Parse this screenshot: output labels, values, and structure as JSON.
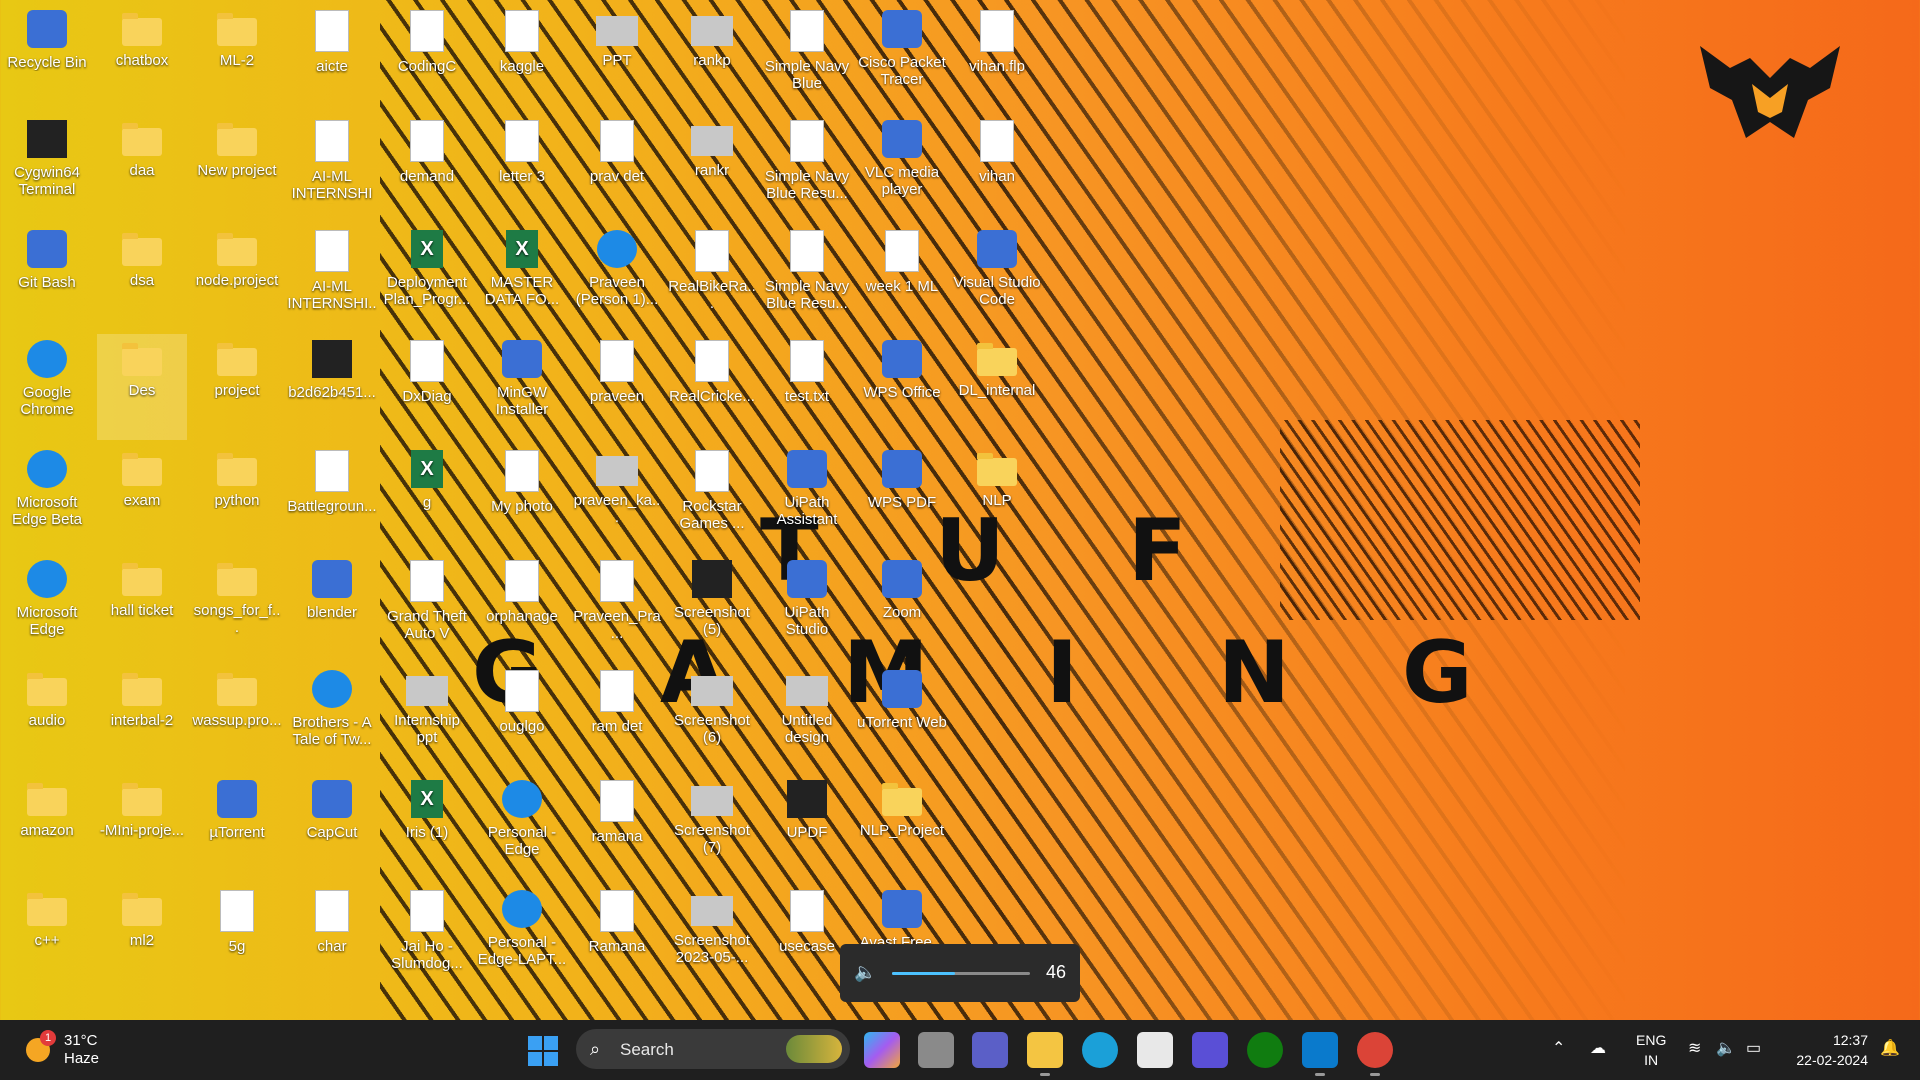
{
  "wallpaper": {
    "tuf_letters": [
      "T",
      "U",
      "F"
    ],
    "gaming_letters": [
      "G",
      "A",
      "M",
      "I",
      "N",
      "G"
    ]
  },
  "desktop_icons": [
    {
      "label": "Recycle Bin",
      "type": "app",
      "icon": "recycle-bin-icon"
    },
    {
      "label": "chatbox",
      "type": "folder",
      "icon": "folder-icon"
    },
    {
      "label": "ML-2",
      "type": "folder",
      "icon": "folder-icon"
    },
    {
      "label": "aicte",
      "type": "file",
      "icon": "document-icon"
    },
    {
      "label": "CodingC",
      "type": "file",
      "icon": "shortcut-icon"
    },
    {
      "label": "kaggle",
      "type": "file",
      "icon": "document-icon"
    },
    {
      "label": "PPT",
      "type": "img",
      "icon": "image-icon"
    },
    {
      "label": "rankp",
      "type": "img",
      "icon": "image-icon"
    },
    {
      "label": "Simple Navy Blue Resume",
      "type": "file",
      "icon": "document-icon"
    },
    {
      "label": "Cisco Packet Tracer",
      "type": "app",
      "icon": "cisco-icon"
    },
    {
      "label": "vihan.flp",
      "type": "file",
      "icon": "file-icon"
    },
    {
      "label": "Cygwin64 Terminal",
      "type": "dark",
      "icon": "terminal-icon"
    },
    {
      "label": "daa",
      "type": "folder",
      "icon": "folder-icon"
    },
    {
      "label": "New project",
      "type": "folder",
      "icon": "folder-icon"
    },
    {
      "label": "AI-ML INTERNSHIP",
      "type": "file",
      "icon": "document-icon"
    },
    {
      "label": "demand",
      "type": "file",
      "icon": "document-icon"
    },
    {
      "label": "letter 3",
      "type": "file",
      "icon": "document-icon"
    },
    {
      "label": "prav det",
      "type": "file",
      "icon": "document-icon"
    },
    {
      "label": "rankr",
      "type": "img",
      "icon": "image-icon"
    },
    {
      "label": "Simple Navy Blue Resu...",
      "type": "file",
      "icon": "document-icon"
    },
    {
      "label": "VLC media player",
      "type": "app",
      "icon": "vlc-icon"
    },
    {
      "label": "vihan",
      "type": "file",
      "icon": "media-icon"
    },
    {
      "label": "Git Bash",
      "type": "app",
      "icon": "git-icon"
    },
    {
      "label": "dsa",
      "type": "folder",
      "icon": "folder-icon"
    },
    {
      "label": "node.project",
      "type": "folder",
      "icon": "folder-icon"
    },
    {
      "label": "AI-ML INTERNSHI...",
      "type": "file",
      "icon": "document-icon"
    },
    {
      "label": "Deployment Plan_Progr...",
      "type": "excel",
      "icon": "excel-icon"
    },
    {
      "label": "MASTER DATA FO...",
      "type": "excel",
      "icon": "excel-icon"
    },
    {
      "label": "Praveen (Person 1)...",
      "type": "round",
      "icon": "chrome-icon"
    },
    {
      "label": "RealBikeRa...",
      "type": "file",
      "icon": "shortcut-icon"
    },
    {
      "label": "Simple Navy Blue Resu...",
      "type": "file",
      "icon": "document-icon"
    },
    {
      "label": "week 1 ML",
      "type": "file",
      "icon": "document-icon"
    },
    {
      "label": "Visual Studio Code",
      "type": "app",
      "icon": "vscode-icon"
    },
    {
      "label": "Google Chrome",
      "type": "round",
      "icon": "chrome-icon"
    },
    {
      "label": "Des",
      "type": "folder",
      "icon": "folder-icon",
      "selected": true
    },
    {
      "label": "project",
      "type": "folder",
      "icon": "folder-icon"
    },
    {
      "label": "b2d62b451...",
      "type": "dark",
      "icon": "image-icon"
    },
    {
      "label": "DxDiag",
      "type": "file",
      "icon": "document-icon"
    },
    {
      "label": "MinGW Installer",
      "type": "app",
      "icon": "mingw-icon"
    },
    {
      "label": "praveen",
      "type": "file",
      "icon": "document-icon"
    },
    {
      "label": "RealCricke...",
      "type": "file",
      "icon": "shortcut-icon"
    },
    {
      "label": "test.txt",
      "type": "file",
      "icon": "text-file-icon"
    },
    {
      "label": "WPS Office",
      "type": "app",
      "icon": "wps-icon"
    },
    {
      "label": "DL_internal",
      "type": "folder",
      "icon": "folder-icon"
    },
    {
      "label": "Microsoft Edge Beta",
      "type": "round",
      "icon": "edge-beta-icon"
    },
    {
      "label": "exam",
      "type": "folder",
      "icon": "folder-icon"
    },
    {
      "label": "python",
      "type": "folder",
      "icon": "folder-icon"
    },
    {
      "label": "Battlegroun...",
      "type": "file",
      "icon": "shortcut-icon"
    },
    {
      "label": "g",
      "type": "excel",
      "icon": "excel-icon"
    },
    {
      "label": "My photo",
      "type": "file",
      "icon": "photo-icon"
    },
    {
      "label": "praveen_ka...",
      "type": "img",
      "icon": "image-icon"
    },
    {
      "label": "Rockstar Games ...",
      "type": "file",
      "icon": "shortcut-icon"
    },
    {
      "label": "UiPath Assistant",
      "type": "app",
      "icon": "uipath-icon"
    },
    {
      "label": "WPS PDF",
      "type": "app",
      "icon": "wps-pdf-icon"
    },
    {
      "label": "NLP",
      "type": "folder",
      "icon": "folder-icon"
    },
    {
      "label": "Microsoft Edge",
      "type": "round",
      "icon": "edge-icon"
    },
    {
      "label": "hall ticket",
      "type": "folder",
      "icon": "folder-icon"
    },
    {
      "label": "songs_for_f...",
      "type": "folder",
      "icon": "folder-icon"
    },
    {
      "label": "blender",
      "type": "app",
      "icon": "blender-icon"
    },
    {
      "label": "Grand Theft Auto V",
      "type": "file",
      "icon": "shortcut-icon"
    },
    {
      "label": "orphanage",
      "type": "file",
      "icon": "document-icon"
    },
    {
      "label": "Praveen_Pra...",
      "type": "file",
      "icon": "document-icon"
    },
    {
      "label": "Screenshot (5)",
      "type": "dark",
      "icon": "image-icon"
    },
    {
      "label": "UiPath Studio",
      "type": "app",
      "icon": "uipath-studio-icon"
    },
    {
      "label": "Zoom",
      "type": "app",
      "icon": "zoom-icon"
    },
    {
      "label": "audio",
      "type": "folder",
      "icon": "folder-icon"
    },
    {
      "label": "interbal-2",
      "type": "folder",
      "icon": "folder-icon"
    },
    {
      "label": "wassup.pro...",
      "type": "folder",
      "icon": "folder-icon"
    },
    {
      "label": "Brothers - A Tale of Tw...",
      "type": "round",
      "icon": "globe-icon"
    },
    {
      "label": "Internship ppt",
      "type": "img",
      "icon": "image-icon"
    },
    {
      "label": "ouglgo",
      "type": "file",
      "icon": "document-icon"
    },
    {
      "label": "ram det",
      "type": "file",
      "icon": "document-icon"
    },
    {
      "label": "Screenshot (6)",
      "type": "img",
      "icon": "image-icon"
    },
    {
      "label": "Untitled design",
      "type": "img",
      "icon": "image-icon"
    },
    {
      "label": "uTorrent Web",
      "type": "app",
      "icon": "utorrent-icon"
    },
    {
      "label": "amazon",
      "type": "folder",
      "icon": "folder-icon"
    },
    {
      "label": "-MIni-proje...",
      "type": "folder",
      "icon": "folder-icon"
    },
    {
      "label": "µTorrent",
      "type": "app",
      "icon": "utorrent-icon"
    },
    {
      "label": "CapCut",
      "type": "app",
      "icon": "capcut-icon"
    },
    {
      "label": "Iris (1)",
      "type": "excel",
      "icon": "excel-icon"
    },
    {
      "label": "Personal - Edge",
      "type": "round",
      "icon": "edge-icon"
    },
    {
      "label": "ramana",
      "type": "file",
      "icon": "document-icon"
    },
    {
      "label": "Screenshot (7)",
      "type": "img",
      "icon": "image-icon"
    },
    {
      "label": "UPDF",
      "type": "dark",
      "icon": "updf-icon"
    },
    {
      "label": "NLP_Project",
      "type": "folder",
      "icon": "folder-icon"
    },
    {
      "label": "c++",
      "type": "folder",
      "icon": "folder-icon"
    },
    {
      "label": "ml2",
      "type": "folder",
      "icon": "folder-icon"
    },
    {
      "label": "5g",
      "type": "file",
      "icon": "document-icon"
    },
    {
      "label": "char",
      "type": "file",
      "icon": "file-icon"
    },
    {
      "label": "Jai Ho - Slumdog...",
      "type": "file",
      "icon": "media-icon"
    },
    {
      "label": "Personal - Edge-LAPT...",
      "type": "round",
      "icon": "edge-icon"
    },
    {
      "label": "Ramana",
      "type": "file",
      "icon": "document-icon"
    },
    {
      "label": "Screenshot 2023-05-...",
      "type": "img",
      "icon": "image-icon"
    },
    {
      "label": "usecase",
      "type": "file",
      "icon": "document-icon"
    },
    {
      "label": "Avast Free...",
      "type": "app",
      "icon": "avast-icon"
    }
  ],
  "volume_flyout": {
    "value": "46",
    "level": 0.46
  },
  "taskbar": {
    "weather": {
      "badge": "1",
      "temp": "31°C",
      "condition": "Haze"
    },
    "search_label": "Search",
    "tray": {
      "lang_line1": "ENG",
      "lang_line2": "IN",
      "time": "12:37",
      "date": "22-02-2024"
    }
  },
  "colors": {
    "accent": "#4cc2ff",
    "taskbar": "#1f1f1f"
  }
}
